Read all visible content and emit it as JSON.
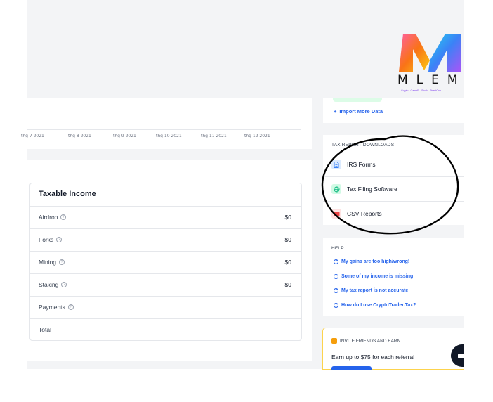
{
  "chart": {
    "x_ticks": [
      "thg 7 2021",
      "thg 8 2021",
      "thg 9 2021",
      "thg 10 2021",
      "thg 11 2021",
      "thg 12 2021"
    ]
  },
  "taxable_income": {
    "title": "Taxable Income",
    "help_glyph": "?",
    "rows": [
      {
        "label": "Airdrop",
        "value": "$0"
      },
      {
        "label": "Forks",
        "value": "$0"
      },
      {
        "label": "Mining",
        "value": "$0"
      },
      {
        "label": "Staking",
        "value": "$0"
      },
      {
        "label": "Payments",
        "value": ""
      },
      {
        "label": "Total",
        "value": ""
      }
    ]
  },
  "import": {
    "link": "Import More Data",
    "plus_glyph": "+"
  },
  "downloads": {
    "title": "TAX REPORT DOWNLOADS",
    "items": [
      {
        "label": "IRS Forms",
        "icon": "document-icon",
        "color": "#3b82f6"
      },
      {
        "label": "Tax Filing Software",
        "icon": "globe-icon",
        "color": "#10b981"
      },
      {
        "label": "CSV Reports",
        "icon": "csv-icon",
        "color": "#ef4444"
      }
    ]
  },
  "help": {
    "title": "HELP",
    "question_glyph": "?",
    "links": [
      "My gains are too high/wrong!",
      "Some of my income is missing",
      "My tax report is not accurate",
      "How do I use CryptoTrader.Tax?"
    ]
  },
  "invite": {
    "title": "INVITE FRIENDS AND EARN",
    "text": "Earn up to $75 for each referral"
  },
  "logo": {
    "text": "MLEM",
    "tagline": "- Crypto - GameFi - Stock - StreetOne -"
  },
  "colors": {
    "accent": "#2563eb",
    "annotation": "#000000"
  }
}
